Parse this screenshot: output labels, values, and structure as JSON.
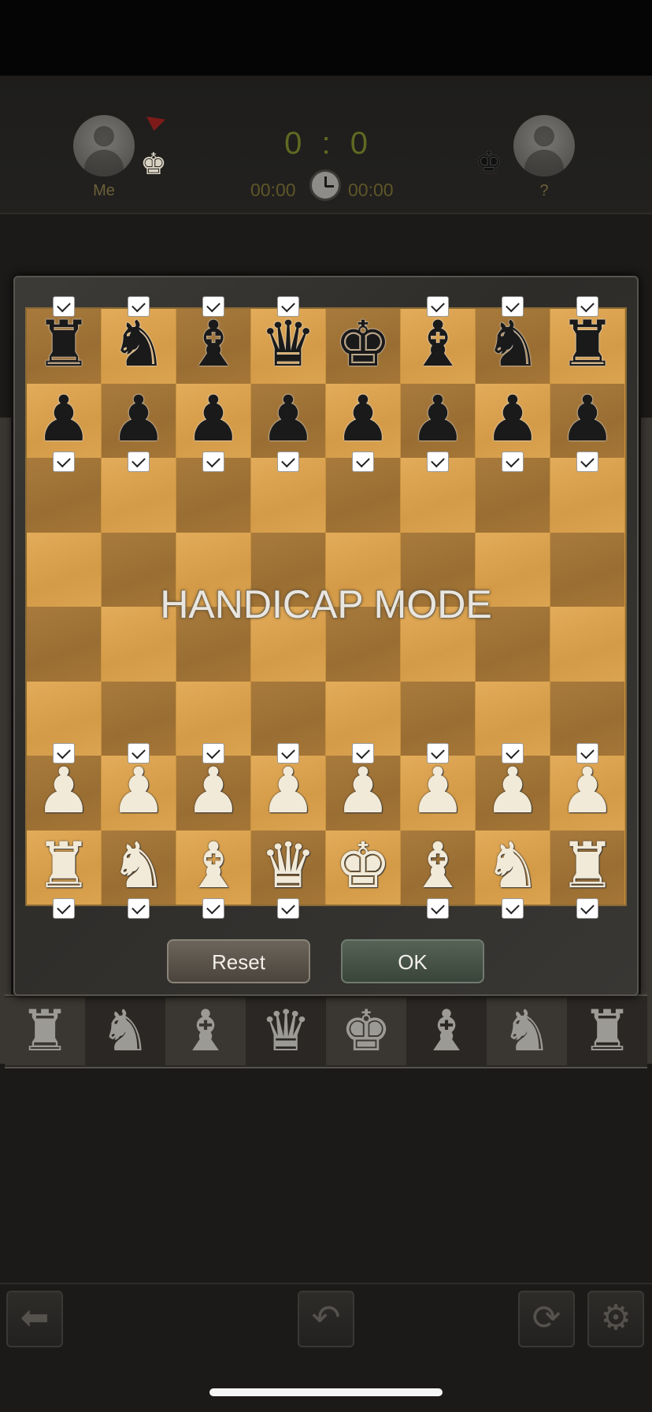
{
  "header": {
    "player_left_name": "Me",
    "player_right_name": "?",
    "score_left": "0",
    "score_sep": ":",
    "score_right": "0",
    "timer_left": "00:00",
    "timer_right": "00:00"
  },
  "dialog": {
    "title_overlay": "HANDICAP MODE",
    "reset_label": "Reset",
    "ok_label": "OK",
    "black_back_rank": [
      "♜",
      "♞",
      "♝",
      "♛",
      "♚",
      "♝",
      "♞",
      "♜"
    ],
    "black_pawns": [
      "♟",
      "♟",
      "♟",
      "♟",
      "♟",
      "♟",
      "♟",
      "♟"
    ],
    "white_pawns": [
      "♟",
      "♟",
      "♟",
      "♟",
      "♟",
      "♟",
      "♟",
      "♟"
    ],
    "white_back_rank": [
      "♜",
      "♞",
      "♝",
      "♛",
      "♚",
      "♝",
      "♞",
      "♜"
    ],
    "checked": {
      "black_back_rank": [
        true,
        true,
        true,
        true,
        false,
        true,
        true,
        true
      ],
      "black_pawns": [
        true,
        true,
        true,
        true,
        true,
        true,
        true,
        true
      ],
      "white_pawns": [
        true,
        true,
        true,
        true,
        true,
        true,
        true,
        true
      ],
      "white_back_rank": [
        true,
        true,
        true,
        true,
        false,
        true,
        true,
        true
      ]
    }
  },
  "background_rank": [
    "♜",
    "♞",
    "♝",
    "♛",
    "♚",
    "♝",
    "♞",
    "♜"
  ],
  "toolbar": {
    "back_icon": "arrow-left-icon",
    "undo_icon": "undo-icon",
    "flip_icon": "rotate-icon",
    "settings_icon": "gear-icon"
  },
  "colors": {
    "score": "#5e6a22",
    "timer": "#5e5628",
    "board_light": "#e3ac5a",
    "board_dark": "#a87a3c"
  }
}
